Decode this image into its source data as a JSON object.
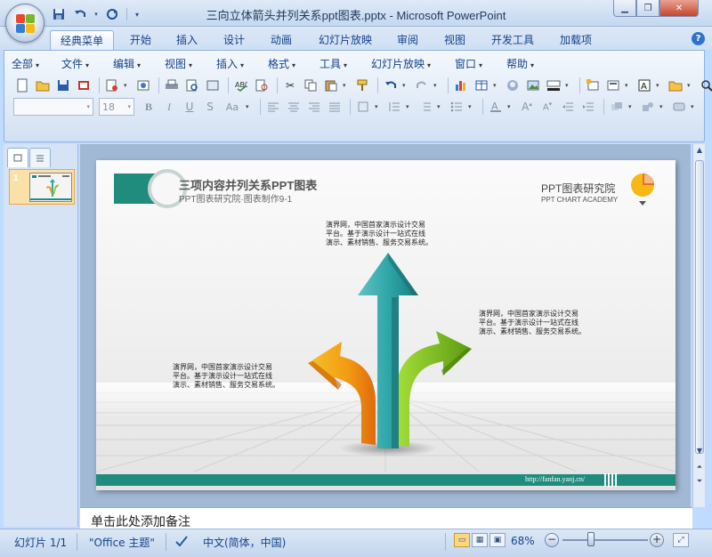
{
  "window": {
    "title": "三向立体箭头并列关系ppt图表.pptx - Microsoft PowerPoint"
  },
  "quick_access": {
    "icons": [
      "save-icon",
      "undo-icon",
      "redo-icon",
      "customize-icon"
    ]
  },
  "ribbon_tabs": [
    "经典菜单",
    "开始",
    "插入",
    "设计",
    "动画",
    "幻灯片放映",
    "审阅",
    "视图",
    "开发工具",
    "加载项"
  ],
  "active_tab": "经典菜单",
  "classic_menu": [
    "全部",
    "文件",
    "编辑",
    "视图",
    "插入",
    "格式",
    "工具",
    "幻灯片放映",
    "窗口",
    "帮助"
  ],
  "format_bar": {
    "font_name": "",
    "font_size": "18",
    "bold": "B",
    "italic": "I",
    "underline": "U",
    "strike": "S",
    "case": "Aa"
  },
  "slides_panel": {
    "slide_number": "1"
  },
  "slide": {
    "title": "三项内容并列关系PPT图表",
    "subtitle": "PPT图表研究院·图表制作9-1",
    "brand": "PPT图表研究院",
    "brand_sub": "PPT CHART ACADEMY",
    "text_top": [
      "演界网，中国首家演示设计交易",
      "平台。基于演示设计一站式在线",
      "演示、素材销售、服务交易系统。"
    ],
    "text_right": [
      "演界网，中国首家演示设计交易",
      "平台。基于演示设计一站式在线",
      "演示、素材销售、服务交易系统。"
    ],
    "text_left": [
      "演界网，中国首家演示设计交易",
      "平台。基于演示设计一站式在线",
      "演示、素材销售、服务交易系统。"
    ],
    "url": "http://fanfan.yanj.cn/",
    "colors": {
      "teal": "#1f8c7e",
      "arrow_blue": "#2fa6a8",
      "arrow_green": "#7ec21b",
      "arrow_orange": "#f29a12"
    }
  },
  "notes": {
    "placeholder": "单击此处添加备注"
  },
  "status_bar": {
    "slide_info": "幻灯片 1/1",
    "theme": "\"Office 主题\"",
    "language": "中文(简体，中国)",
    "zoom": "68%"
  }
}
